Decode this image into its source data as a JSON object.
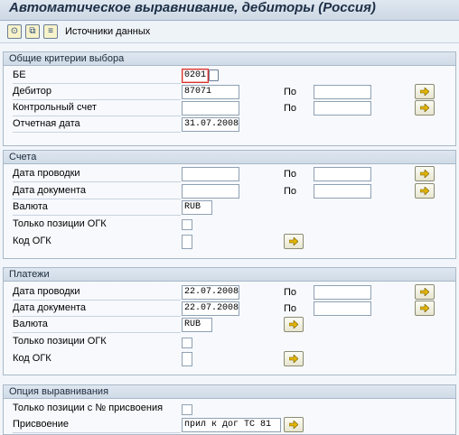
{
  "window": {
    "title": "Автоматическое выравнивание, дебиторы (Россия)"
  },
  "toolbar": {
    "data_sources_label": "Источники данных"
  },
  "groups": {
    "general": {
      "title": "Общие критерии выбора",
      "be_label": "БЕ",
      "be_value": "0201",
      "debtor_label": "Дебитор",
      "debtor_from": "87071",
      "debtor_to": "",
      "control_account_label": "Контрольный счет",
      "control_from": "",
      "control_to": "",
      "report_date_label": "Отчетная дата",
      "report_date_value": "31.07.2008",
      "to_label": "По"
    },
    "invoices": {
      "title": "Счета",
      "posting_date_label": "Дата проводки",
      "posting_from": "",
      "posting_to": "",
      "doc_date_label": "Дата документа",
      "doc_from": "",
      "doc_to": "",
      "currency_label": "Валюта",
      "currency_value": "RUB",
      "only_ogk_label": "Только позиции ОГК",
      "ogk_code_label": "Код ОГК",
      "ogk_code_value": "",
      "to_label": "По"
    },
    "payments": {
      "title": "Платежи",
      "posting_date_label": "Дата проводки",
      "posting_from": "22.07.2008",
      "posting_to": "",
      "doc_date_label": "Дата документа",
      "doc_from": "22.07.2008",
      "doc_to": "",
      "currency_label": "Валюта",
      "currency_value": "RUB",
      "only_ogk_label": "Только позиции ОГК",
      "ogk_code_label": "Код ОГК",
      "ogk_code_value": "",
      "to_label": "По"
    },
    "options": {
      "title": "Опция выравнивания",
      "only_assignment_label": "Только позиции с № присвоения",
      "assignment_label": "Присвоение",
      "assignment_value": "прил к дог ТС 81"
    }
  }
}
